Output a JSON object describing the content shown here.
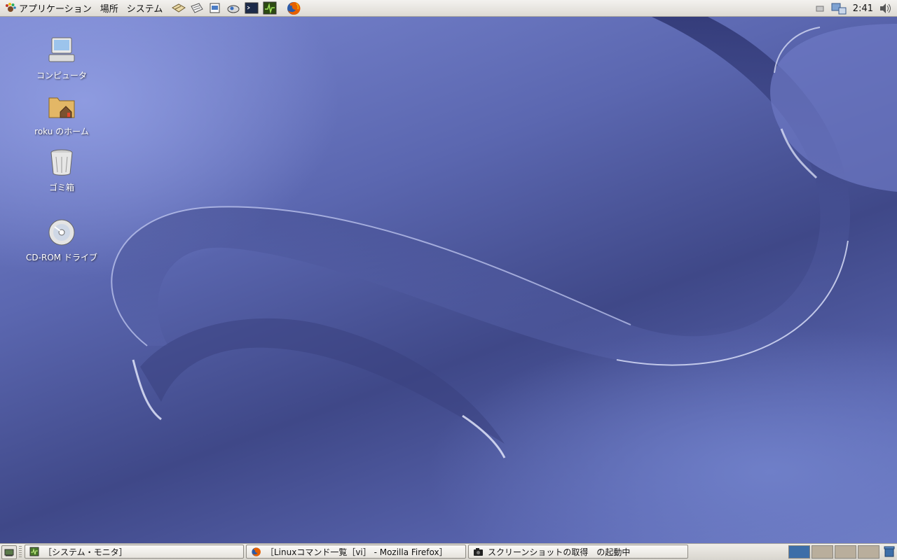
{
  "top_panel": {
    "menus": [
      {
        "label": "アプリケーション"
      },
      {
        "label": "場所"
      },
      {
        "label": "システム"
      }
    ],
    "launchers": [
      "mail-icon",
      "notes-icon",
      "writer-icon",
      "drawing-icon",
      "terminal-icon",
      "system-monitor-icon",
      "firefox-icon"
    ],
    "clock": "2:41"
  },
  "desktop": {
    "icons": [
      {
        "label": "コンピュータ",
        "icon": "computer-icon"
      },
      {
        "label": "roku のホーム",
        "icon": "home-folder-icon"
      },
      {
        "label": "ゴミ箱",
        "icon": "trash-icon"
      },
      {
        "label": "CD-ROM ドライブ",
        "icon": "cdrom-icon"
      }
    ]
  },
  "bottom_panel": {
    "tasks": [
      {
        "label": "［システム・モニタ］",
        "icon": "system-monitor-icon"
      },
      {
        "label": "［Linuxコマンド一覧［vi］ - Mozilla Firefox］",
        "icon": "firefox-icon"
      },
      {
        "label": "スクリーンショットの取得　の起動中",
        "icon": "camera-icon"
      }
    ],
    "workspaces": [
      {
        "name": "workspace-1",
        "active": true
      },
      {
        "name": "workspace-2",
        "active": false
      },
      {
        "name": "workspace-3",
        "active": false
      },
      {
        "name": "workspace-4",
        "active": false
      }
    ]
  },
  "colors": {
    "panel": "#e6e3dd",
    "desktop": "#5b67b0",
    "active_workspace": "#3d6ea8"
  }
}
